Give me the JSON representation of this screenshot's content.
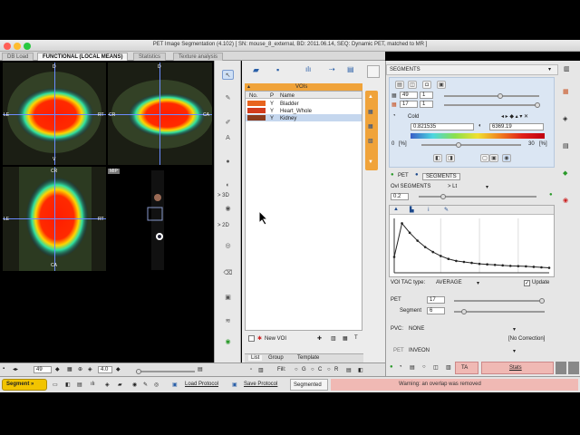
{
  "window": {
    "title": "PET Image Segmentation (4.102)   [ SN: mouse_8_external, BD: 2011.06.14, SEQ: Dynamic PET, matched to MR ]"
  },
  "tabs": [
    "DB Load",
    "FUNCTIONAL (LOCAL MEANS)",
    "Statistics",
    "Texture analysis"
  ],
  "orient": {
    "top_d": "D",
    "left_le": "LE",
    "right_rt": "RT",
    "bottom_v": "V",
    "cr": "CR",
    "ca": "CA",
    "mip": "MIP"
  },
  "tools": {
    "l3d": "> 3D",
    "l2d": "> 2D"
  },
  "voi": {
    "header": "VOIs",
    "cols": [
      "No.",
      "P",
      "Name"
    ],
    "rows": [
      {
        "no": "",
        "p": "Y",
        "name": "Bladder",
        "color": "#e8641e"
      },
      {
        "no": "",
        "p": "Y",
        "name": "Heart_Whole",
        "color": "#d23c1e"
      },
      {
        "no": "",
        "p": "Y",
        "name": "Kidney",
        "color": "#8c3c1e"
      }
    ],
    "new_voi": "New VOI",
    "subtabs": [
      "List",
      "Group",
      "Template"
    ],
    "fill": "Fill:",
    "fill_g": "G",
    "fill_c": "C",
    "fill_r": "R"
  },
  "seg": {
    "header": "SEGMENTS",
    "val1": "49",
    "val1b": "1",
    "val2": "17",
    "val2b": "1",
    "colormap": "Cold",
    "min": "0.821535",
    "max": "6369.19",
    "pct_lo": "0",
    "pct_hi": "30",
    "pct_unit": "[%]",
    "src_pet": "PET",
    "src_seg": "SEGMENTS",
    "ovl": "Ovl SEGMENTS",
    "lt": "> Lt",
    "ovl_val": "0.2",
    "tac_type_label": "VOI TAC type:",
    "tac_type": "AVERAGE",
    "update": "Update",
    "pet_label": "PET",
    "pet_val": "17",
    "segment_label": "Segment",
    "segment_val": "6",
    "pvc_label": "PVC:",
    "pvc_val": "NONE",
    "nocorr": "[No Correction]",
    "pet2": "PET",
    "inveon": "INVEON",
    "ta": "TA",
    "stats": "Stats"
  },
  "chart_data": {
    "type": "line",
    "x": [
      0,
      1,
      2,
      3,
      4,
      5,
      6,
      7,
      8,
      9,
      10,
      11,
      12,
      13,
      14,
      15,
      16,
      17,
      18,
      19,
      20
    ],
    "values": [
      3.2,
      10.0,
      8.1,
      6.5,
      5.2,
      4.2,
      3.4,
      2.8,
      2.4,
      2.2,
      2.0,
      1.8,
      1.7,
      1.6,
      1.5,
      1.4,
      1.35,
      1.3,
      1.2,
      1.1,
      1.0
    ],
    "ylim": [
      0,
      11
    ]
  },
  "bottom": {
    "slice": "49",
    "zoom": "4.0",
    "segment_btn": "Segment »",
    "load_protocol": "Load Protocol",
    "save_protocol": "Save Protocol",
    "segmented": "Segmented",
    "warning": "Warning: an overlap was removed"
  }
}
